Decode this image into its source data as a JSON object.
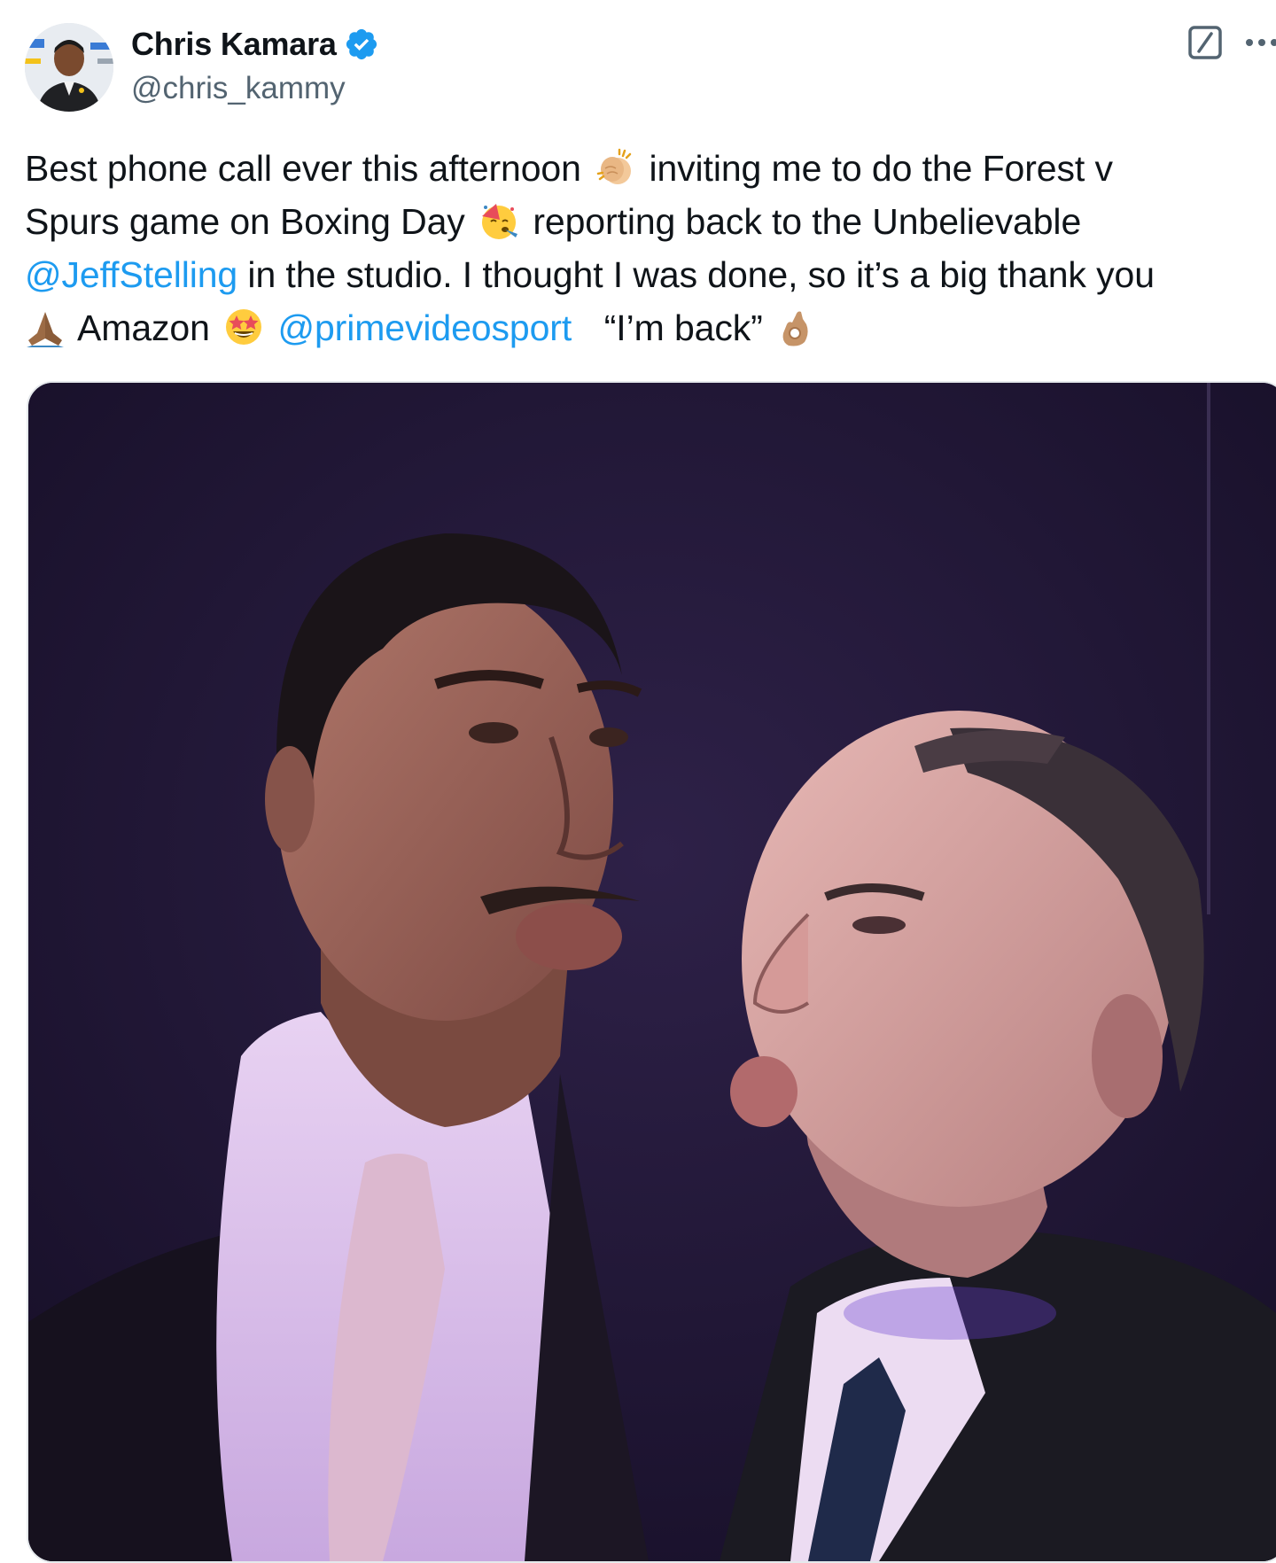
{
  "tweet": {
    "author": {
      "display_name": "Chris Kamara",
      "handle": "@chris_kammy",
      "verified": true,
      "verified_color": "#1d9bf0"
    },
    "actions": {
      "grok_icon": "grok-icon",
      "more_icon": "more-icon"
    },
    "text": {
      "line1_a": "Best phone call ever this afternoon",
      "line1_b": "inviting me to do the Forest v",
      "line2_a": "Spurs game on Boxing Day",
      "line2_b": "reporting back to the Unbelievable",
      "line3_mention": "@JeffStelling",
      "line3_b": " in the studio. I thought I was done, so it’s a big thank you",
      "line4_a": "Amazon",
      "line4_mention": "@primevideosport",
      "line4_b": "“I’m back”"
    },
    "emojis": [
      "clapping-hands",
      "partying-face",
      "folded-hands",
      "star-struck",
      "ok-hand"
    ],
    "colors": {
      "text": "#0f1419",
      "secondary": "#536471",
      "link": "#1d9bf0"
    },
    "media": {
      "type": "photo"
    }
  }
}
